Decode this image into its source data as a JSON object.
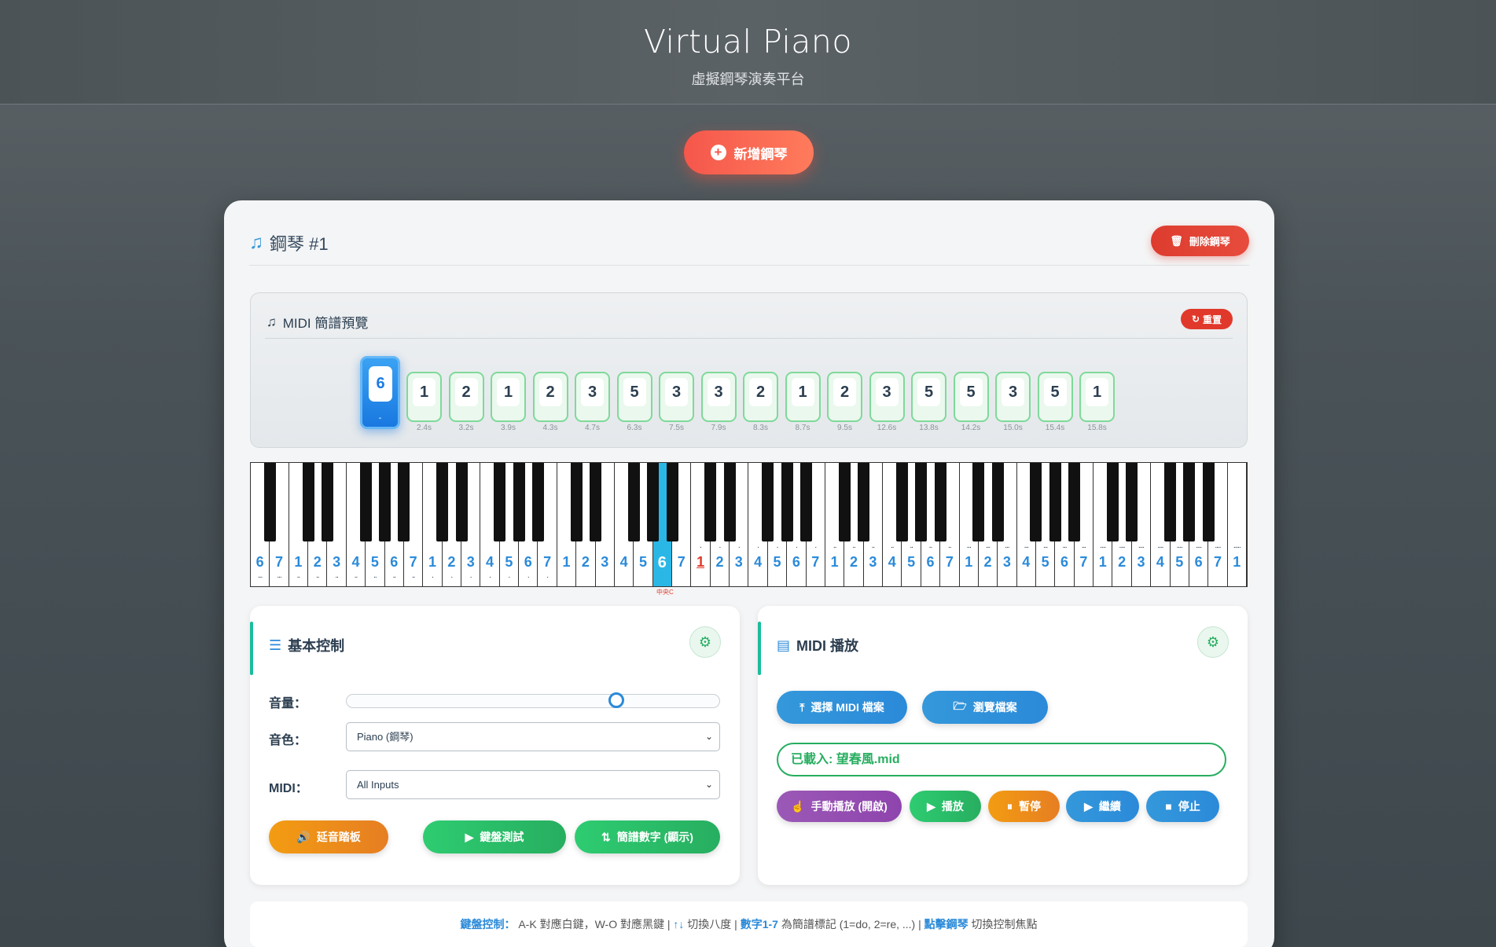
{
  "header": {
    "title": "Virtual Piano",
    "subtitle": "虛擬鋼琴演奏平台"
  },
  "add_piano_label": "新增鋼琴",
  "piano": {
    "title": "鋼琴 #1",
    "delete_label": "刪除鋼琴"
  },
  "preview": {
    "title": "MIDI 簡譜預覽",
    "reset_label": "重置",
    "active_note": {
      "num": "6",
      "dot": "-"
    },
    "notes": [
      {
        "num": "1",
        "time": "2.4s"
      },
      {
        "num": "2",
        "time": "3.2s"
      },
      {
        "num": "1",
        "time": "3.9s"
      },
      {
        "num": "2",
        "time": "4.3s"
      },
      {
        "num": "3",
        "time": "4.7s"
      },
      {
        "num": "5",
        "time": "6.3s"
      },
      {
        "num": "3",
        "time": "7.5s"
      },
      {
        "num": "3",
        "time": "7.9s"
      },
      {
        "num": "2",
        "time": "8.3s"
      },
      {
        "num": "1",
        "time": "8.7s"
      },
      {
        "num": "2",
        "time": "9.5s"
      },
      {
        "num": "3",
        "time": "12.6s"
      },
      {
        "num": "5",
        "time": "13.8s"
      },
      {
        "num": "5",
        "time": "14.2s"
      },
      {
        "num": "3",
        "time": "15.0s"
      },
      {
        "num": "5",
        "time": "15.4s"
      },
      {
        "num": "1",
        "time": "15.8s"
      }
    ]
  },
  "keyboard": {
    "white_keys": [
      "6",
      "7",
      "1",
      "2",
      "3",
      "4",
      "5",
      "6",
      "7",
      "1",
      "2",
      "3",
      "4",
      "5",
      "6",
      "7",
      "1",
      "2",
      "3",
      "4",
      "5",
      "6",
      "7",
      "1",
      "2",
      "3",
      "4",
      "5",
      "6",
      "7",
      "1",
      "2",
      "3",
      "4",
      "5",
      "6",
      "7",
      "1",
      "2",
      "3",
      "4",
      "5",
      "6",
      "7",
      "1",
      "2",
      "3",
      "4",
      "5",
      "6",
      "7",
      "1"
    ],
    "highlighted_index": 21,
    "middle_c_index": 23,
    "middle_c_label": "中央C"
  },
  "basic_control": {
    "title": "基本控制",
    "volume_label": "音量：",
    "volume_level": 0.73,
    "timbre_label": "音色：",
    "timbre_value": "Piano (鋼琴)",
    "midi_label": "MIDI：",
    "midi_value": "All Inputs",
    "sustain_label": "延音踏板",
    "test_label": "鍵盤測試",
    "notation_label": "簡譜數字 (顯示)"
  },
  "midi_play": {
    "title": "MIDI 播放",
    "choose_label": "選擇 MIDI 檔案",
    "browse_label": "瀏覽檔案",
    "loaded_text": "已載入: 望春風.mid",
    "manual_label": "手動播放 (開啟)",
    "play_label": "播放",
    "pause_label": "暫停",
    "resume_label": "繼續",
    "stop_label": "停止"
  },
  "hint": {
    "k1": "鍵盤控制：",
    "t1": " A-K 對應白鍵，W-O 對應黑鍵 | ",
    "k2": "↑↓",
    "t2": " 切換八度 | ",
    "k3": "數字1-7",
    "t3": " 為簡譜標記 (1=do, 2=re, ...) | ",
    "k4": "點擊鋼琴",
    "t4": " 切換控制焦點"
  },
  "colors": {
    "accent": "#2b8ad9",
    "add_button": "#f5574b",
    "delete": "#e74c3c",
    "green": "#27ae60",
    "orange": "#f39c12",
    "purple": "#9b59b6",
    "key_highlight": "#2bb7e6"
  }
}
